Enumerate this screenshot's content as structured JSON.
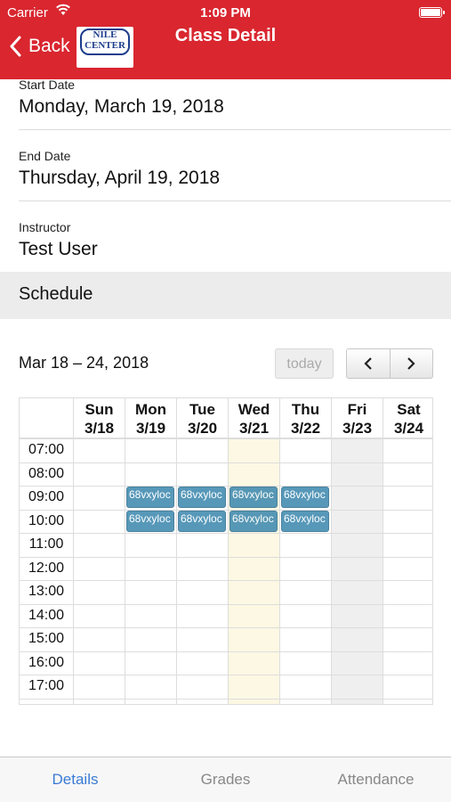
{
  "status": {
    "carrier": "Carrier",
    "time": "1:09 PM"
  },
  "nav": {
    "back_label": "Back",
    "title": "Class Detail",
    "logo_line1": "NILE",
    "logo_line2": "CENTER"
  },
  "details": {
    "start_label": "Start Date",
    "start_value": "Monday, March 19, 2018",
    "end_label": "End Date",
    "end_value": "Thursday, April 19, 2018",
    "instructor_label": "Instructor",
    "instructor_value": "Test User"
  },
  "schedule": {
    "section_label": "Schedule",
    "range": "Mar 18 – 24, 2018",
    "today_label": "today",
    "days": [
      {
        "dow": "Sun",
        "date": "3/18"
      },
      {
        "dow": "Mon",
        "date": "3/19"
      },
      {
        "dow": "Tue",
        "date": "3/20"
      },
      {
        "dow": "Wed",
        "date": "3/21"
      },
      {
        "dow": "Thu",
        "date": "3/22"
      },
      {
        "dow": "Fri",
        "date": "3/23"
      },
      {
        "dow": "Sat",
        "date": "3/24"
      }
    ],
    "times": [
      "07:00",
      "08:00",
      "09:00",
      "10:00",
      "11:00",
      "12:00",
      "13:00",
      "14:00",
      "15:00",
      "16:00",
      "17:00"
    ],
    "events": [
      {
        "day": "Mon",
        "slot": "09:00",
        "label": "68vxyloc"
      },
      {
        "day": "Tue",
        "slot": "09:00",
        "label": "68vxyloc"
      },
      {
        "day": "Wed",
        "slot": "09:00",
        "label": "68vxyloc"
      },
      {
        "day": "Thu",
        "slot": "09:00",
        "label": "68vxyloc"
      },
      {
        "day": "Mon",
        "slot": "10:00",
        "label": "68vxyloc"
      },
      {
        "day": "Tue",
        "slot": "10:00",
        "label": "68vxyloc"
      },
      {
        "day": "Wed",
        "slot": "10:00",
        "label": "68vxyloc"
      },
      {
        "day": "Thu",
        "slot": "10:00",
        "label": "68vxyloc"
      }
    ],
    "today_day": "Wed",
    "colors": {
      "event": "#3a87ad",
      "today_bg": "#fcf8e3"
    }
  },
  "tabs": [
    {
      "label": "Details",
      "active": true
    },
    {
      "label": "Grades",
      "active": false
    },
    {
      "label": "Attendance",
      "active": false
    }
  ],
  "colors": {
    "brand": "#d9262f",
    "tab_active": "#3a7bd5"
  }
}
